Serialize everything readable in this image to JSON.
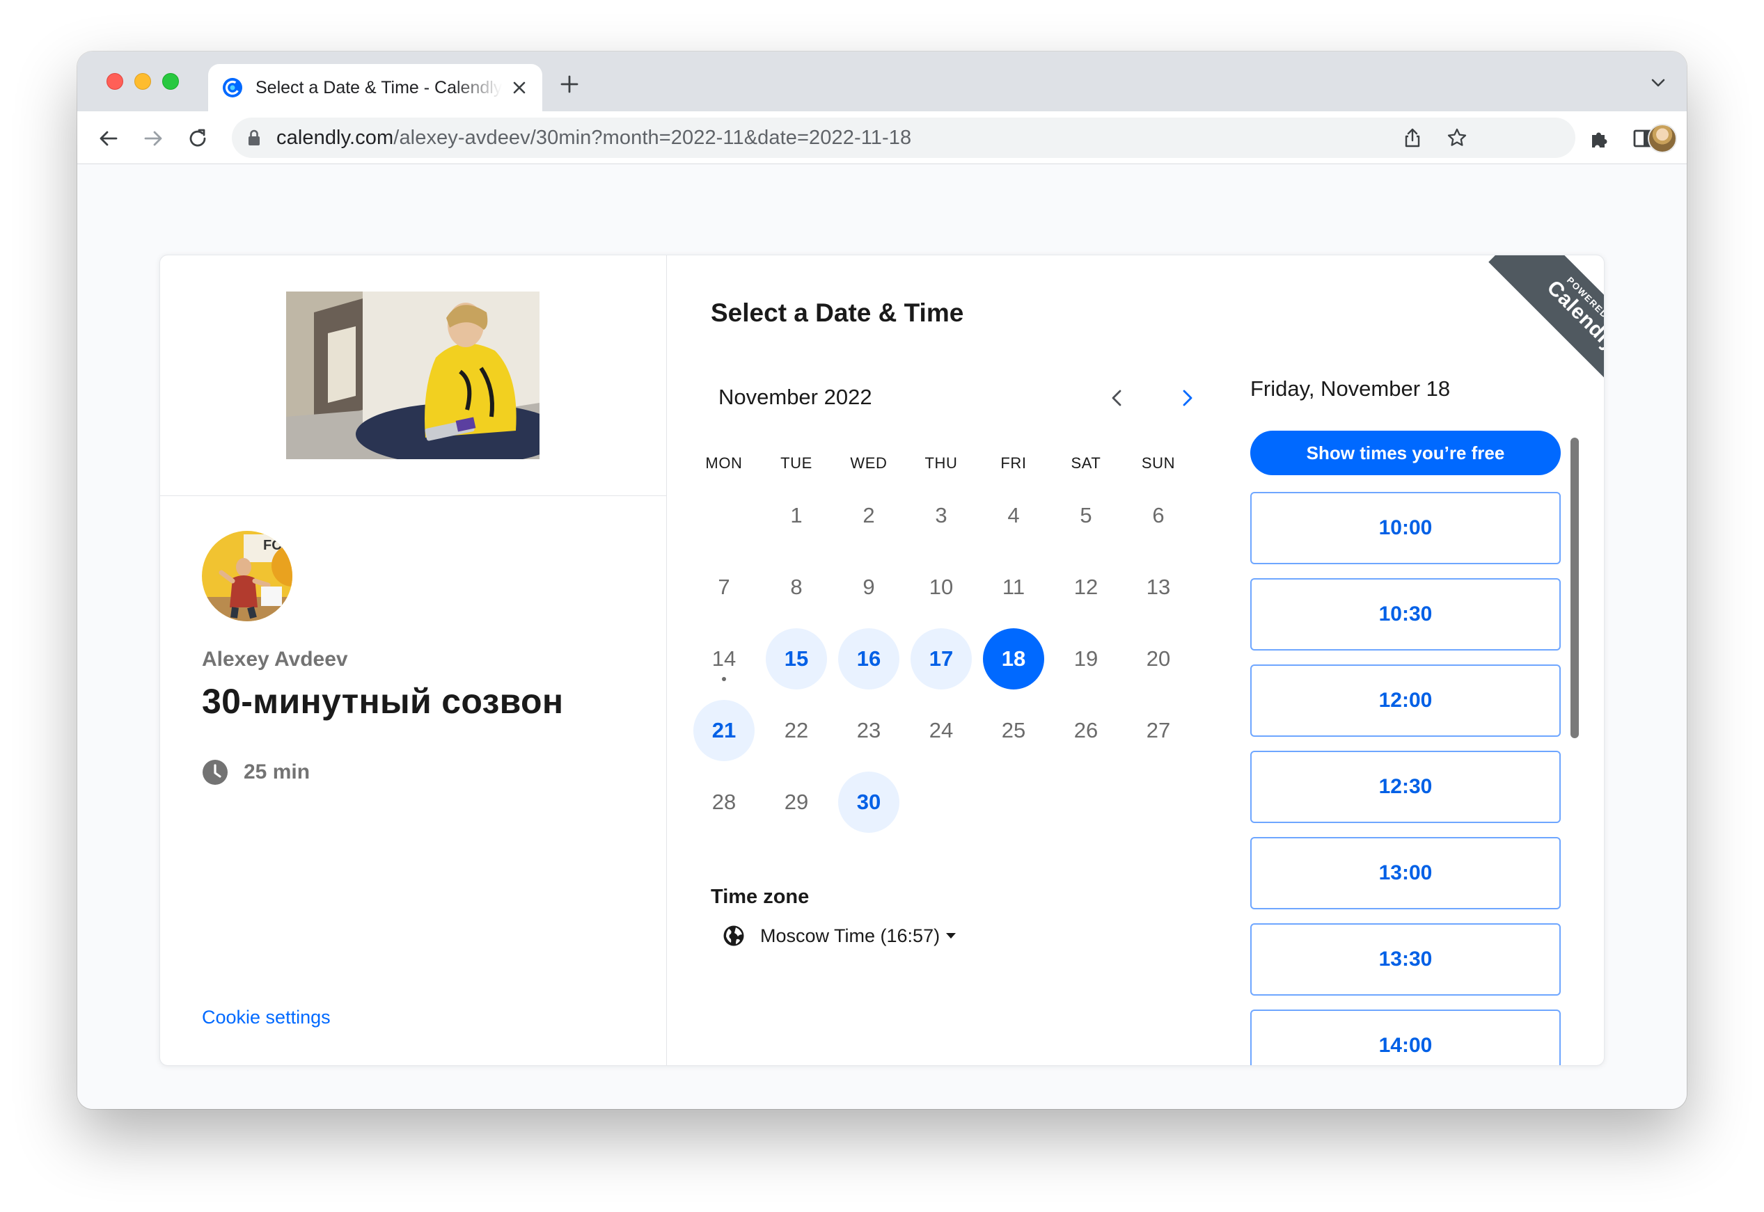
{
  "browser": {
    "tab_title": "Select a Date & Time - Calendly",
    "url_host": "calendly.com",
    "url_path": "/alexey-avdeev/30min?month=2022-11&date=2022-11-18"
  },
  "event": {
    "host_name": "Alexey Avdeev",
    "title": "30-минутный созвон",
    "duration": "25 min",
    "cookie_link": "Cookie settings"
  },
  "calendar": {
    "section_title": "Select a Date & Time",
    "month_label": "November 2022",
    "weekdays": [
      "MON",
      "TUE",
      "WED",
      "THU",
      "FRI",
      "SAT",
      "SUN"
    ],
    "days": [
      {
        "d": "1",
        "col": 1,
        "row": 0,
        "state": "default"
      },
      {
        "d": "2",
        "col": 2,
        "row": 0,
        "state": "default"
      },
      {
        "d": "3",
        "col": 3,
        "row": 0,
        "state": "default"
      },
      {
        "d": "4",
        "col": 4,
        "row": 0,
        "state": "default"
      },
      {
        "d": "5",
        "col": 5,
        "row": 0,
        "state": "default"
      },
      {
        "d": "6",
        "col": 6,
        "row": 0,
        "state": "default"
      },
      {
        "d": "7",
        "col": 0,
        "row": 1,
        "state": "default"
      },
      {
        "d": "8",
        "col": 1,
        "row": 1,
        "state": "default"
      },
      {
        "d": "9",
        "col": 2,
        "row": 1,
        "state": "default"
      },
      {
        "d": "10",
        "col": 3,
        "row": 1,
        "state": "default"
      },
      {
        "d": "11",
        "col": 4,
        "row": 1,
        "state": "default"
      },
      {
        "d": "12",
        "col": 5,
        "row": 1,
        "state": "default"
      },
      {
        "d": "13",
        "col": 6,
        "row": 1,
        "state": "default"
      },
      {
        "d": "14",
        "col": 0,
        "row": 2,
        "state": "today"
      },
      {
        "d": "15",
        "col": 1,
        "row": 2,
        "state": "available"
      },
      {
        "d": "16",
        "col": 2,
        "row": 2,
        "state": "available"
      },
      {
        "d": "17",
        "col": 3,
        "row": 2,
        "state": "available"
      },
      {
        "d": "18",
        "col": 4,
        "row": 2,
        "state": "selected"
      },
      {
        "d": "19",
        "col": 5,
        "row": 2,
        "state": "default"
      },
      {
        "d": "20",
        "col": 6,
        "row": 2,
        "state": "default"
      },
      {
        "d": "21",
        "col": 0,
        "row": 3,
        "state": "available"
      },
      {
        "d": "22",
        "col": 1,
        "row": 3,
        "state": "default"
      },
      {
        "d": "23",
        "col": 2,
        "row": 3,
        "state": "default"
      },
      {
        "d": "24",
        "col": 3,
        "row": 3,
        "state": "default"
      },
      {
        "d": "25",
        "col": 4,
        "row": 3,
        "state": "default"
      },
      {
        "d": "26",
        "col": 5,
        "row": 3,
        "state": "default"
      },
      {
        "d": "27",
        "col": 6,
        "row": 3,
        "state": "default"
      },
      {
        "d": "28",
        "col": 0,
        "row": 4,
        "state": "default"
      },
      {
        "d": "29",
        "col": 1,
        "row": 4,
        "state": "default"
      },
      {
        "d": "30",
        "col": 2,
        "row": 4,
        "state": "available"
      }
    ],
    "timezone_label": "Time zone",
    "timezone_value": "Moscow Time (16:57)"
  },
  "times": {
    "date_heading": "Friday, November 18",
    "free_button": "Show times you’re free",
    "slots": [
      "10:00",
      "10:30",
      "12:00",
      "12:30",
      "13:00",
      "13:30",
      "14:00"
    ]
  },
  "badge": {
    "powered_by": "POWERED BY",
    "brand": "Calendly"
  },
  "colors": {
    "accent": "#0069ff",
    "available_bg": "#e9f2ff",
    "ribbon": "#505960"
  }
}
